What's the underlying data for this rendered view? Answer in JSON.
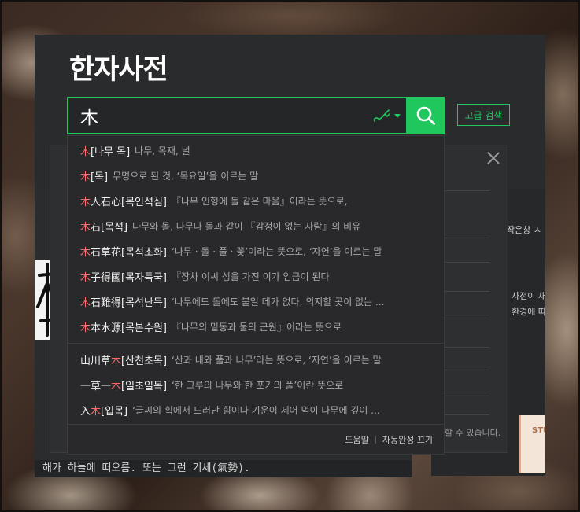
{
  "page": {
    "title": "한자사전"
  },
  "search": {
    "value": "木",
    "advanced_label": "고급 검색"
  },
  "colors": {
    "accent": "#1fc75d",
    "highlight": "#ff6b6b",
    "panel_bg": "#2a2b2d"
  },
  "suggestions_group1": [
    {
      "hl": "木",
      "rest": "[나무 목]",
      "desc": "나무, 목재, 널"
    },
    {
      "hl": "木",
      "rest": "[목]",
      "desc": "무명으로 된 것, ‘목요일’을 이르는 말"
    },
    {
      "hl": "木",
      "rest": "人石心[목인석심]",
      "desc": "『나무 인형에 돌 같은 마음』이라는 뜻으로,"
    },
    {
      "hl": "木",
      "rest": "石[목석]",
      "desc": "나무와 돌, 나무나 돌과 같이 『감정이 없는 사람』의 비유"
    },
    {
      "hl": "木",
      "rest": "石草花[목석초화]",
      "desc": "‘나무 · 돌 · 풀 · 꽃’이라는 뜻으로, ‘자연’을 이르는 말"
    },
    {
      "hl": "木",
      "rest": "子得國[목자득국]",
      "desc": "『장차 이씨 성을 가진 이가 임금이 된다"
    },
    {
      "hl": "木",
      "rest": "石難得[목석난득]",
      "desc": "‘나무에도 돌에도 붙일 데가 없다, 의지할 곳이 없는 ..."
    },
    {
      "hl": "木",
      "rest": "本水源[목본수원]",
      "desc": "『나무의 밑동과 물의 근원』이라는 뜻으로"
    }
  ],
  "suggestions_group2": [
    {
      "pre": "山川草",
      "hl": "木",
      "rest": "[산천초목]",
      "desc": "‘산과 내와 풀과 나무’라는 뜻으로, ‘자연’을 이르는 말"
    },
    {
      "pre": "一草一",
      "hl": "木",
      "rest": "[일초일목]",
      "desc": "‘한 그루의 나무와 한 포기의 풀’이란 뜻으로"
    },
    {
      "pre": "入",
      "hl": "木",
      "rest": "[입목]",
      "desc": "‘글씨의 획에서 드러난 힘이나 기운이 세어 먹이 나무에 깊이 ..."
    }
  ],
  "dropdown_footer": {
    "help": "도움말",
    "autocomplete_off": "자동완성 끄기"
  },
  "background_page": {
    "right_text_1": "작은창 ㅅ",
    "right_text_2": "사전이 새",
    "right_text_3": "환경에 따",
    "modal_footer": "할 수 있습니다.",
    "card_label": "STU",
    "left_text": "해가 하늘에 떠오름. 또는 그런 기세(氣勢)."
  }
}
